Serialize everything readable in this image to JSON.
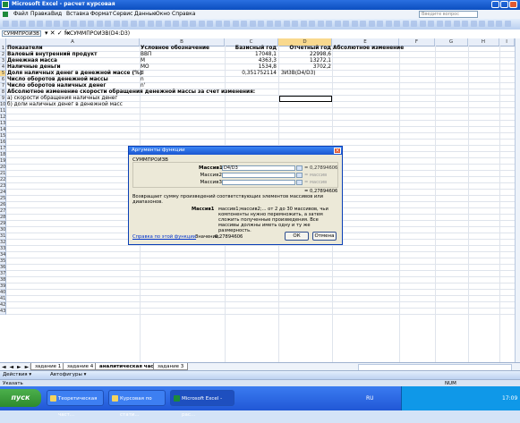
{
  "window": {
    "title": "Microsoft Excel - расчет курсовая"
  },
  "menu": [
    "Файл",
    "Правка",
    "Вид",
    "Вставка",
    "Формат",
    "Сервис",
    "Данные",
    "Окно",
    "Справка"
  ],
  "help_placeholder": "Введите вопрос",
  "formula_bar": {
    "name_box": "СУММПРОИЗВ",
    "buttons": "▾ ✕ ✓ fx",
    "formula": "=СУММПРОИЗВ(D4:D3)"
  },
  "columns": [
    "A",
    "B",
    "C",
    "D",
    "E",
    "F",
    "G",
    "H",
    "I"
  ],
  "rows": [
    {
      "n": "1",
      "a": "Показатели",
      "b": "Условное обозначение",
      "c": "Базисный год",
      "d": "Отчетный год",
      "e": "Абсолютное изменение",
      "bold": true
    },
    {
      "n": "2",
      "a": "Валовый внутренний продукт",
      "b": "ВВП",
      "c": "17048,1",
      "d": "22998,6",
      "e": "",
      "bold": false,
      "abold": true
    },
    {
      "n": "3",
      "a": "Денежная масса",
      "b": "М",
      "c": "4363,3",
      "d": "13272,1",
      "e": "",
      "abold": true
    },
    {
      "n": "4",
      "a": "Наличные деньги",
      "b": "МО",
      "c": "1534,8",
      "d": "3702,2",
      "e": "",
      "abold": true
    },
    {
      "n": "5",
      "a": "Доля наличных денег в денежной массе (%)",
      "b": "d",
      "c": "0,351752114",
      "d": "ЗИ3В(D4/D3)",
      "e": "",
      "abold": true
    },
    {
      "n": "6",
      "a": "Число оборотов денежной массы",
      "b": "n",
      "c": "",
      "d": "",
      "e": "",
      "abold": true
    },
    {
      "n": "7",
      "a": "Число оборотов наличных денег",
      "b": "n'",
      "c": "",
      "d": "",
      "e": "",
      "abold": true
    },
    {
      "n": "8",
      "a": "    Абсолютное изменение скорости обращения денежной массы за счет изменения:",
      "b": "",
      "c": "",
      "d": "",
      "e": "",
      "abold": true
    },
    {
      "n": "9",
      "a": "а) скорости обращения наличных денег",
      "b": "",
      "c": "",
      "d": "",
      "e": ""
    },
    {
      "n": "10",
      "a": "б) доли наличных денег в денежной масс",
      "b": "",
      "c": "",
      "d": "",
      "e": ""
    }
  ],
  "row_count": 43,
  "sheet_tabs": [
    "задание 1",
    "задание 4",
    "аналитическая часть",
    "задание 3"
  ],
  "active_tab": "аналитическая часть",
  "draw_bar": {
    "actions": "Действия ▾",
    "autoshapes": "Автофигуры ▾"
  },
  "status": {
    "left": "Указать",
    "right": "NUM"
  },
  "dialog": {
    "title": "Аргументы функции",
    "function_name": "СУММПРОИЗВ",
    "args": [
      {
        "label": "Массив1",
        "value": "D4/D3",
        "result": "= 0,27894606",
        "bold": true
      },
      {
        "label": "Массив2",
        "value": "",
        "result": "= массив"
      },
      {
        "label": "Массив3",
        "value": "",
        "result": "= массив"
      }
    ],
    "total": "= 0,27894606",
    "description": "Возвращает сумму произведений соответствующих элементов массивов или диапазонов.",
    "arg_help_label": "Массив1",
    "arg_help_text": "массив1;массив2;... от 2 до 30 массивов, чьи компоненты нужно перемножить, а затем сложить полученные произведения. Все массивы должны иметь одну и ту же размерность.",
    "help_link": "Справка по этой функции",
    "value_label": "Значение:",
    "value": "0,27894606",
    "ok": "ОК",
    "cancel": "Отмена"
  },
  "taskbar": {
    "start": "пуск",
    "tasks": [
      "Теоретическая част...",
      "Курсовая по стати...",
      "Microsoft Excel - рас..."
    ],
    "lang": "RU",
    "clock": "17:09"
  }
}
